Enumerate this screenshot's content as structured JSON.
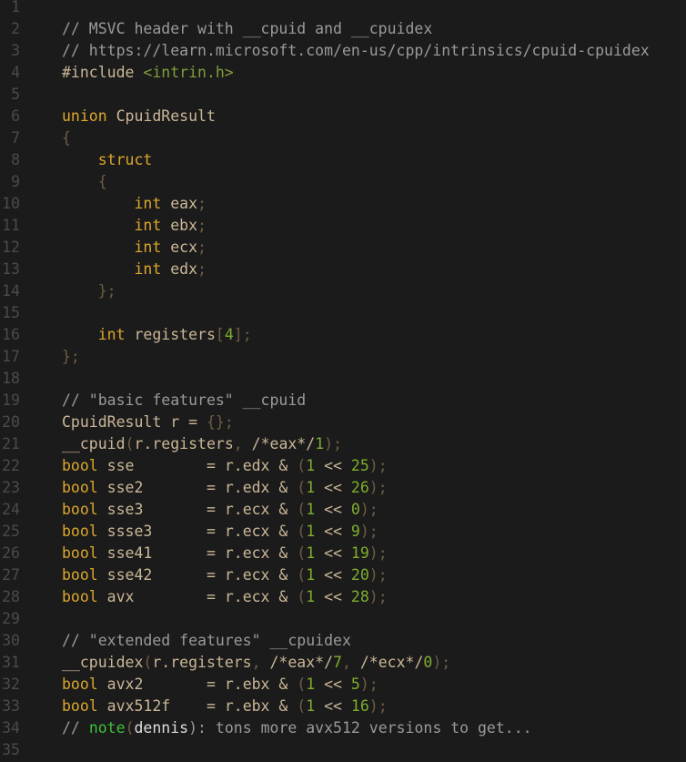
{
  "lines": [
    [],
    [
      [
        "// MSVC header with __cpuid and __cpuidex",
        "c"
      ]
    ],
    [
      [
        "// https://learn.microsoft.com/en-us/cpp/intrinsics/cpuid-cpuidex",
        "c"
      ]
    ],
    [
      [
        "#include ",
        "i"
      ],
      [
        "<intrin.h>",
        "s"
      ]
    ],
    [],
    [
      [
        "union",
        "k"
      ],
      [
        " CpuidResult",
        "i"
      ]
    ],
    [
      [
        "{",
        "p"
      ]
    ],
    [
      [
        "    struct",
        "k"
      ]
    ],
    [
      [
        "    {",
        "p"
      ]
    ],
    [
      [
        "        int",
        "k"
      ],
      [
        " eax",
        "i"
      ],
      [
        ";",
        "p"
      ]
    ],
    [
      [
        "        int",
        "k"
      ],
      [
        " ebx",
        "i"
      ],
      [
        ";",
        "p"
      ]
    ],
    [
      [
        "        int",
        "k"
      ],
      [
        " ecx",
        "i"
      ],
      [
        ";",
        "p"
      ]
    ],
    [
      [
        "        int",
        "k"
      ],
      [
        " edx",
        "i"
      ],
      [
        ";",
        "p"
      ]
    ],
    [
      [
        "    };",
        "p"
      ]
    ],
    [],
    [
      [
        "    int",
        "k"
      ],
      [
        " registers",
        "i"
      ],
      [
        "[",
        "p"
      ],
      [
        "4",
        "n"
      ],
      [
        "];",
        "p"
      ]
    ],
    [
      [
        "};",
        "p"
      ]
    ],
    [],
    [
      [
        "// \"basic features\" __cpuid",
        "c"
      ]
    ],
    [
      [
        "CpuidResult r = ",
        "i"
      ],
      [
        "{};",
        "p"
      ]
    ],
    [
      [
        "__cpuid",
        "i"
      ],
      [
        "(",
        "p"
      ],
      [
        "r.registers",
        "i"
      ],
      [
        ", ",
        "p"
      ],
      [
        "/*eax*/",
        "i"
      ],
      [
        "1",
        "n"
      ],
      [
        ");",
        "p"
      ]
    ],
    [
      [
        "bool",
        "k"
      ],
      [
        " sse        = r.edx & ",
        "i"
      ],
      [
        "(",
        "p"
      ],
      [
        "1",
        "n"
      ],
      [
        " << ",
        "i"
      ],
      [
        "25",
        "n"
      ],
      [
        ");",
        "p"
      ]
    ],
    [
      [
        "bool",
        "k"
      ],
      [
        " sse2       = r.edx & ",
        "i"
      ],
      [
        "(",
        "p"
      ],
      [
        "1",
        "n"
      ],
      [
        " << ",
        "i"
      ],
      [
        "26",
        "n"
      ],
      [
        ");",
        "p"
      ]
    ],
    [
      [
        "bool",
        "k"
      ],
      [
        " sse3       = r.ecx & ",
        "i"
      ],
      [
        "(",
        "p"
      ],
      [
        "1",
        "n"
      ],
      [
        " << ",
        "i"
      ],
      [
        "0",
        "n"
      ],
      [
        ");",
        "p"
      ]
    ],
    [
      [
        "bool",
        "k"
      ],
      [
        " ssse3      = r.ecx & ",
        "i"
      ],
      [
        "(",
        "p"
      ],
      [
        "1",
        "n"
      ],
      [
        " << ",
        "i"
      ],
      [
        "9",
        "n"
      ],
      [
        ");",
        "p"
      ]
    ],
    [
      [
        "bool",
        "k"
      ],
      [
        " sse41      = r.ecx & ",
        "i"
      ],
      [
        "(",
        "p"
      ],
      [
        "1",
        "n"
      ],
      [
        " << ",
        "i"
      ],
      [
        "19",
        "n"
      ],
      [
        ");",
        "p"
      ]
    ],
    [
      [
        "bool",
        "k"
      ],
      [
        " sse42      = r.ecx & ",
        "i"
      ],
      [
        "(",
        "p"
      ],
      [
        "1",
        "n"
      ],
      [
        " << ",
        "i"
      ],
      [
        "20",
        "n"
      ],
      [
        ");",
        "p"
      ]
    ],
    [
      [
        "bool",
        "k"
      ],
      [
        " avx        = r.ecx & ",
        "i"
      ],
      [
        "(",
        "p"
      ],
      [
        "1",
        "n"
      ],
      [
        " << ",
        "i"
      ],
      [
        "28",
        "n"
      ],
      [
        ");",
        "p"
      ]
    ],
    [],
    [
      [
        "// \"extended features\" __cpuidex",
        "c"
      ]
    ],
    [
      [
        "__cpuidex",
        "i"
      ],
      [
        "(",
        "p"
      ],
      [
        "r.registers",
        "i"
      ],
      [
        ", ",
        "p"
      ],
      [
        "/*eax*/",
        "i"
      ],
      [
        "7",
        "n"
      ],
      [
        ", ",
        "p"
      ],
      [
        "/*ecx*/",
        "i"
      ],
      [
        "0",
        "n"
      ],
      [
        ");",
        "p"
      ]
    ],
    [
      [
        "bool",
        "k"
      ],
      [
        " avx2       = r.ebx & ",
        "i"
      ],
      [
        "(",
        "p"
      ],
      [
        "1",
        "n"
      ],
      [
        " << ",
        "i"
      ],
      [
        "5",
        "n"
      ],
      [
        ");",
        "p"
      ]
    ],
    [
      [
        "bool",
        "k"
      ],
      [
        " avx512f    = r.ebx & ",
        "i"
      ],
      [
        "(",
        "p"
      ],
      [
        "1",
        "n"
      ],
      [
        " << ",
        "i"
      ],
      [
        "16",
        "n"
      ],
      [
        ");",
        "p"
      ]
    ],
    [
      [
        "// ",
        "c"
      ],
      [
        "note",
        "t"
      ],
      [
        "(",
        "p"
      ],
      [
        "dennis",
        "d"
      ],
      [
        "): tons more avx512 versions to get...",
        "c"
      ]
    ],
    []
  ],
  "line_numbers": [
    "1",
    "2",
    "3",
    "4",
    "5",
    "6",
    "7",
    "8",
    "9",
    "10",
    "11",
    "12",
    "13",
    "14",
    "15",
    "16",
    "17",
    "18",
    "19",
    "20",
    "21",
    "22",
    "23",
    "24",
    "25",
    "26",
    "27",
    "28",
    "29",
    "30",
    "31",
    "32",
    "33",
    "34",
    "35"
  ]
}
